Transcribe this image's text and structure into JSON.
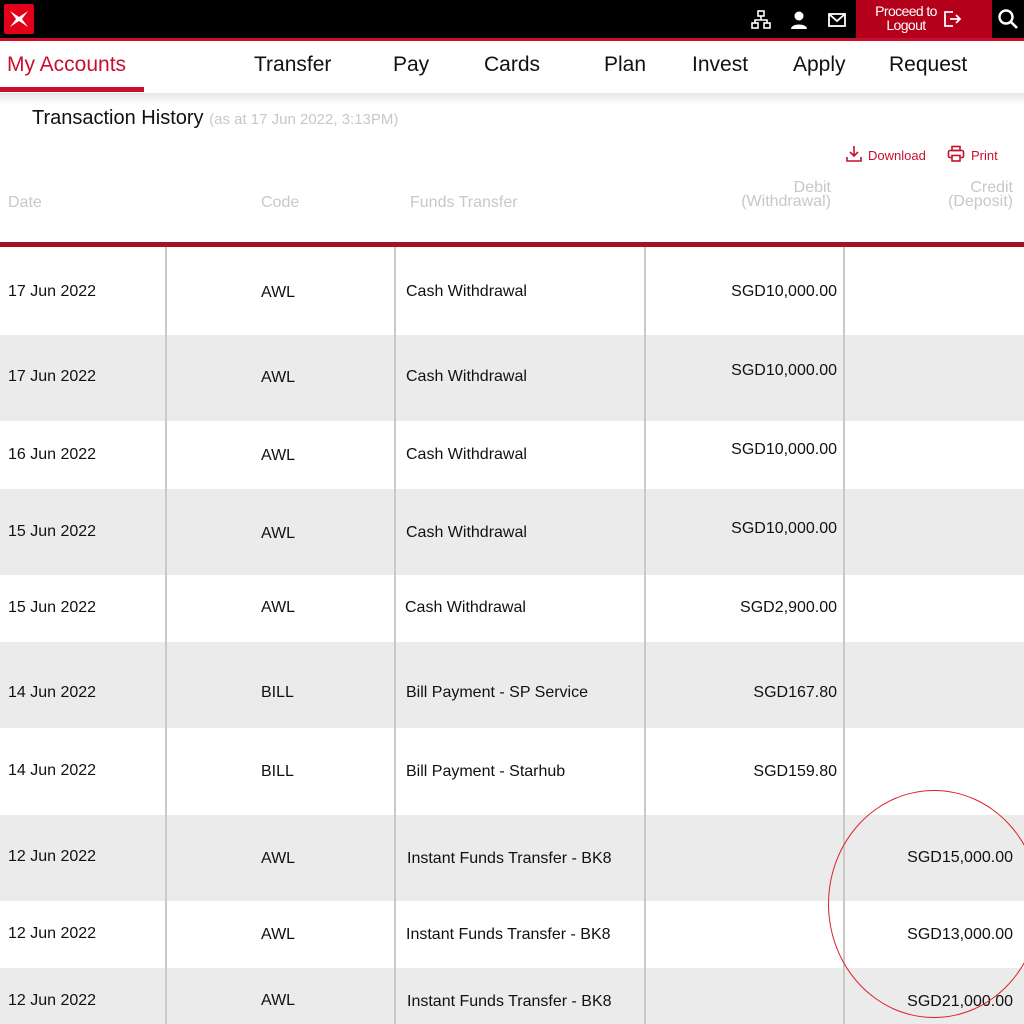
{
  "header": {
    "logout_line1": "Proceed to",
    "logout_line2": "Logout",
    "icons": [
      "logo-icon",
      "sitemap-icon",
      "user-icon",
      "mail-icon",
      "logout-icon",
      "search-icon"
    ]
  },
  "nav": {
    "items": [
      {
        "label": "My Accounts",
        "active": true
      },
      {
        "label": "Transfer"
      },
      {
        "label": "Pay"
      },
      {
        "label": "Cards"
      },
      {
        "label": "Plan"
      },
      {
        "label": "Invest"
      },
      {
        "label": "Apply"
      },
      {
        "label": "Request"
      }
    ]
  },
  "page": {
    "title": "Transaction History",
    "subtitle": "(as at 17 Jun 2022, 3:13PM)"
  },
  "actions": {
    "download": "Download",
    "print": "Print"
  },
  "columns": {
    "date": "Date",
    "code": "Code",
    "description": "Funds Transfer",
    "debit_line1": "Debit",
    "debit_line2": "(Withdrawal)",
    "credit_line1": "Credit",
    "credit_line2": "(Deposit)"
  },
  "rows": [
    {
      "date": "17 Jun 2022",
      "code": "AWL",
      "description": "Cash Withdrawal",
      "debit": "SGD10,000.00",
      "credit": ""
    },
    {
      "date": "17 Jun 2022",
      "code": "AWL",
      "description": "Cash Withdrawal",
      "debit": "SGD10,000.00",
      "credit": ""
    },
    {
      "date": "16 Jun 2022",
      "code": "AWL",
      "description": "Cash Withdrawal",
      "debit": "SGD10,000.00",
      "credit": ""
    },
    {
      "date": "15 Jun 2022",
      "code": "AWL",
      "description": "Cash Withdrawal",
      "debit": "SGD10,000.00",
      "credit": ""
    },
    {
      "date": "15 Jun 2022",
      "code": "AWL",
      "description": "Cash Withdrawal",
      "debit": "SGD2,900.00",
      "credit": ""
    },
    {
      "date": "14 Jun 2022",
      "code": "BILL",
      "description": "Bill Payment - SP Service",
      "debit": "SGD167.80",
      "credit": ""
    },
    {
      "date": "14 Jun 2022",
      "code": "BILL",
      "description": "Bill Payment - Starhub",
      "debit": "SGD159.80",
      "credit": ""
    },
    {
      "date": "12 Jun 2022",
      "code": "AWL",
      "description": "Instant Funds Transfer - BK8",
      "debit": "",
      "credit": "SGD15,000.00"
    },
    {
      "date": "12 Jun 2022",
      "code": "AWL",
      "description": "Instant Funds Transfer - BK8",
      "debit": "",
      "credit": "SGD13,000.00"
    },
    {
      "date": "12 Jun 2022",
      "code": "AWL",
      "description": "Instant Funds Transfer - BK8",
      "debit": "",
      "credit": "SGD21,000.00"
    }
  ],
  "colors": {
    "brand_red": "#c8102e",
    "logout_red": "#b5001c",
    "row_alt": "#ebebeb"
  }
}
